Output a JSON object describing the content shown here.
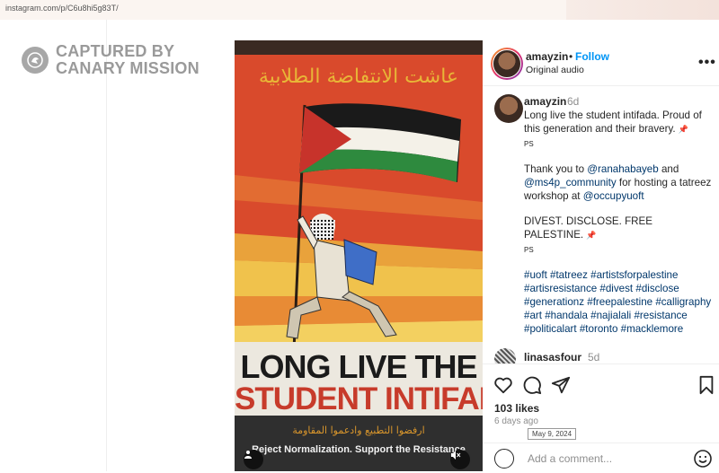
{
  "browser": {
    "url": "instagram.com/p/C6u8hi5g83T/"
  },
  "watermark": {
    "line1": "CAPTURED BY",
    "line2": "CANARY MISSION"
  },
  "poster": {
    "arabic_top": "عاشت الانتفاضة الطلابية",
    "slogan_line1": "LONG LIVE THE",
    "slogan_line2": "STUDENT INTIFADA",
    "arabic_bottom": "ارفضوا التطبيع وادعموا المقاومة",
    "subtitle": "Reject Normalization. Support the Resistance",
    "mute_icon": "speaker-muted-icon"
  },
  "post": {
    "username": "amayzin",
    "follow": "Follow",
    "audio": "Original audio",
    "caption_user": "amayzin",
    "caption_time": "6d",
    "caption_p1": "Long live the student intifada. Proud of this generation and their bravery. ",
    "pin1": "📌",
    "ps1": "PS",
    "caption_p2_a": "Thank you to ",
    "mention1": "@ranahabayeb",
    "caption_p2_b": " and ",
    "mention2": "@ms4p_community",
    "caption_p2_c": " for hosting a tatreez workshop at ",
    "mention3": "@occupyuoft",
    "caption_p3": "DIVEST. DISCLOSE. FREE PALESTINE. ",
    "pin2": "📌",
    "ps2": "PS",
    "hashtags": "#uoft #tatreez #artistsforpalestine #artisresistance #divest #disclose #generationz #freepalestine #calligraphy #art #handala #najialali #resistance #politicalart #toronto #macklemore",
    "comment_user": "linasasfour",
    "comment_time": "5d",
    "likes": "103 likes",
    "ago": "6 days ago",
    "date_tooltip": "May 9, 2024",
    "add_comment_placeholder": "Add a comment..."
  }
}
